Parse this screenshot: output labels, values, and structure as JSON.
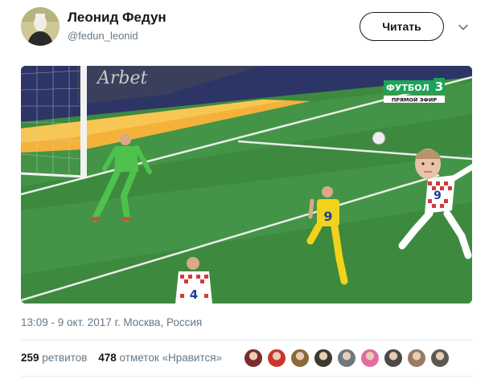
{
  "tweet": {
    "author_name": "Леонид Федун",
    "author_handle": "@fedun_leonid",
    "follow_label": "Читать",
    "timestamp": "13:09 - 9 окт. 2017 г. Москва, Россия",
    "retweets_count": "259",
    "retweets_label": "ретвитов",
    "likes_count": "478",
    "likes_label": "отметок «Нравится»"
  },
  "media": {
    "channel_logo": "ФУТБОЛ",
    "channel_number": "3",
    "live_label": "ПРЯМОЙ ЭФИР",
    "jersey_number_yellow": "9",
    "jersey_number_white_right": "9",
    "jersey_number_white_front": "4",
    "board_text": "Arbet"
  },
  "likers": [
    {
      "icon": "avatar",
      "color": "#7a2c2c"
    },
    {
      "icon": "avatar",
      "color": "#c9352a"
    },
    {
      "icon": "avatar",
      "color": "#8a6a3a"
    },
    {
      "icon": "avatar",
      "color": "#3c3a30"
    },
    {
      "icon": "avatar",
      "color": "#6c7a80"
    },
    {
      "icon": "avatar",
      "color": "#e46aa6"
    },
    {
      "icon": "avatar",
      "color": "#4a4a4a"
    },
    {
      "icon": "avatar",
      "color": "#9a7a64"
    },
    {
      "icon": "avatar",
      "color": "#5a5a50"
    }
  ],
  "colors": {
    "text": "#14171a",
    "secondary": "#657786",
    "divider": "#e6ecf0",
    "channel_green": "#1fa35a"
  }
}
